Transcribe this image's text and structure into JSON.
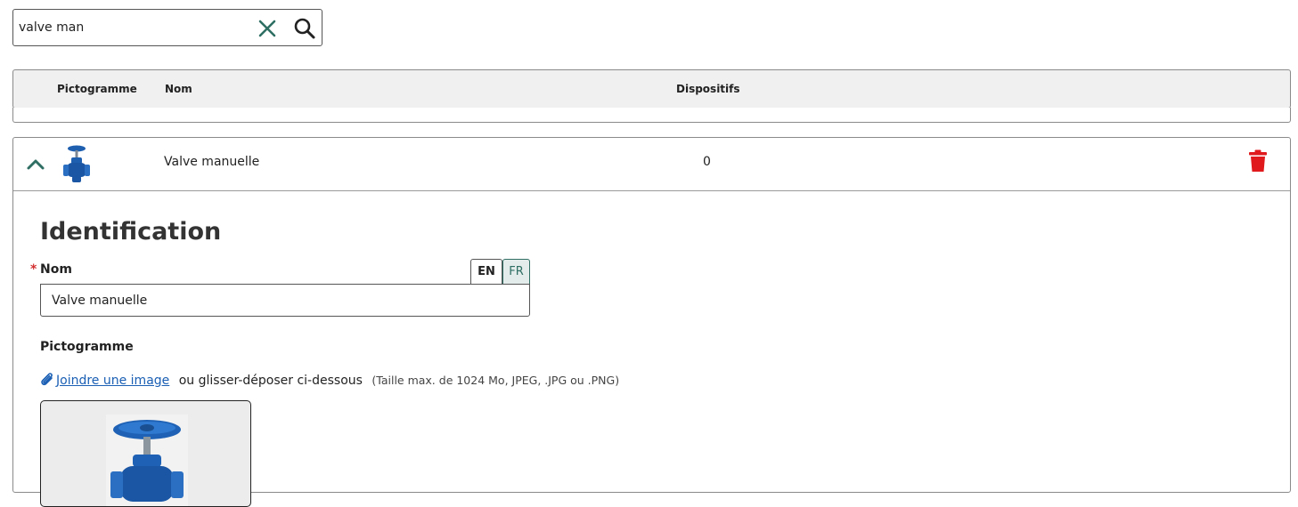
{
  "search": {
    "value": "valve man",
    "icons": {
      "clear": "close-icon",
      "submit": "search-icon"
    },
    "accent_color": "#2e6e63"
  },
  "table": {
    "columns": {
      "pictogramme": "Pictogramme",
      "nom": "Nom",
      "dispositifs": "Dispositifs"
    },
    "rows": [
      {
        "name": "Valve manuelle",
        "dispositifs": "0",
        "expanded": true,
        "icons": {
          "toggle": "chevron-up-icon",
          "delete": "trash-icon"
        },
        "delete_color": "#e0191c"
      }
    ]
  },
  "detail": {
    "section_title": "Identification",
    "required_marker": "*",
    "name_label": "Nom",
    "languages": [
      "EN",
      "FR"
    ],
    "active_language": "EN",
    "name_value": "Valve manuelle",
    "pictogram_label": "Pictogramme",
    "attach_link": "Joindre une image",
    "attach_text": "ou glisser-déposer ci-dessous",
    "attach_hint": "(Taille max. de 1024 Mo, JPEG, .JPG ou .PNG)",
    "link_color": "#1a5fb4"
  }
}
